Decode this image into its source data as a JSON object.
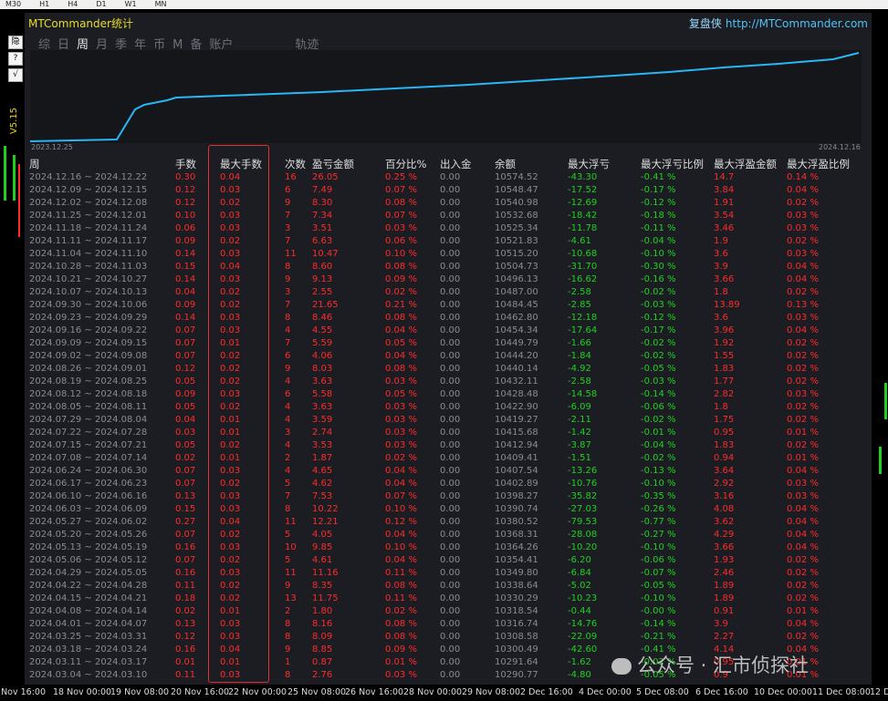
{
  "toolbar": {
    "items": [
      "M30",
      "H1",
      "H4",
      "D1",
      "W1",
      "MN"
    ]
  },
  "side": {
    "version": "V5.15",
    "buttons": [
      "隐",
      "?",
      "√"
    ]
  },
  "panel": {
    "title": "MTCommander统计",
    "brand_cn": "复盘侠",
    "brand_url": "http://MTCommander.com",
    "tabs": [
      "综",
      "日",
      "周",
      "月",
      "季",
      "年",
      "币",
      "M",
      "备",
      "账户",
      "轨迹"
    ],
    "active_tab": "周"
  },
  "equity_chart": {
    "start_date": "2023.12.25",
    "end_date": "2024.12.16"
  },
  "columns": [
    "周",
    "手数",
    "最大手数",
    "次数",
    "盈亏金额",
    "百分比%",
    "出入金",
    "余额",
    "最大浮亏",
    "最大浮亏比例",
    "最大浮盈金额",
    "最大浮盈比例"
  ],
  "rows": [
    [
      "2024.12.16 ~ 2024.12.22",
      "0.30",
      "0.04",
      "16",
      "26.05",
      "0.25 %",
      "0.00",
      "10574.52",
      "-43.30",
      "-0.41 %",
      "14.7",
      "0.14 %"
    ],
    [
      "2024.12.09 ~ 2024.12.15",
      "0.12",
      "0.03",
      "6",
      "7.49",
      "0.07 %",
      "0.00",
      "10548.47",
      "-17.52",
      "-0.17 %",
      "3.84",
      "0.04 %"
    ],
    [
      "2024.12.02 ~ 2024.12.08",
      "0.12",
      "0.02",
      "9",
      "8.30",
      "0.08 %",
      "0.00",
      "10540.98",
      "-12.69",
      "-0.12 %",
      "1.91",
      "0.02 %"
    ],
    [
      "2024.11.25 ~ 2024.12.01",
      "0.10",
      "0.03",
      "7",
      "7.34",
      "0.07 %",
      "0.00",
      "10532.68",
      "-18.42",
      "-0.18 %",
      "3.54",
      "0.03 %"
    ],
    [
      "2024.11.18 ~ 2024.11.24",
      "0.06",
      "0.03",
      "3",
      "3.51",
      "0.03 %",
      "0.00",
      "10525.34",
      "-11.78",
      "-0.11 %",
      "3.46",
      "0.03 %"
    ],
    [
      "2024.11.11 ~ 2024.11.17",
      "0.09",
      "0.02",
      "7",
      "6.63",
      "0.06 %",
      "0.00",
      "10521.83",
      "-4.61",
      "-0.04 %",
      "1.9",
      "0.02 %"
    ],
    [
      "2024.11.04 ~ 2024.11.10",
      "0.14",
      "0.03",
      "11",
      "10.47",
      "0.10 %",
      "0.00",
      "10515.20",
      "-10.68",
      "-0.10 %",
      "3.6",
      "0.03 %"
    ],
    [
      "2024.10.28 ~ 2024.11.03",
      "0.15",
      "0.04",
      "8",
      "8.60",
      "0.08 %",
      "0.00",
      "10504.73",
      "-31.70",
      "-0.30 %",
      "3.9",
      "0.04 %"
    ],
    [
      "2024.10.21 ~ 2024.10.27",
      "0.14",
      "0.03",
      "9",
      "9.13",
      "0.09 %",
      "0.00",
      "10496.13",
      "-16.62",
      "-0.16 %",
      "3.66",
      "0.04 %"
    ],
    [
      "2024.10.07 ~ 2024.10.13",
      "0.04",
      "0.02",
      "3",
      "2.55",
      "0.02 %",
      "0.00",
      "10487.00",
      "-2.58",
      "-0.02 %",
      "1.8",
      "0.02 %"
    ],
    [
      "2024.09.30 ~ 2024.10.06",
      "0.09",
      "0.02",
      "7",
      "21.65",
      "0.21 %",
      "0.00",
      "10484.45",
      "-2.85",
      "-0.03 %",
      "13.89",
      "0.13 %"
    ],
    [
      "2024.09.23 ~ 2024.09.29",
      "0.14",
      "0.03",
      "8",
      "8.46",
      "0.08 %",
      "0.00",
      "10462.80",
      "-12.18",
      "-0.12 %",
      "3.6",
      "0.03 %"
    ],
    [
      "2024.09.16 ~ 2024.09.22",
      "0.07",
      "0.03",
      "4",
      "4.55",
      "0.04 %",
      "0.00",
      "10454.34",
      "-17.64",
      "-0.17 %",
      "3.96",
      "0.04 %"
    ],
    [
      "2024.09.09 ~ 2024.09.15",
      "0.07",
      "0.01",
      "7",
      "5.59",
      "0.05 %",
      "0.00",
      "10449.79",
      "-1.66",
      "-0.02 %",
      "1.92",
      "0.02 %"
    ],
    [
      "2024.09.02 ~ 2024.09.08",
      "0.07",
      "0.02",
      "6",
      "4.06",
      "0.04 %",
      "0.00",
      "10444.20",
      "-1.84",
      "-0.02 %",
      "1.55",
      "0.02 %"
    ],
    [
      "2024.08.26 ~ 2024.09.01",
      "0.12",
      "0.02",
      "9",
      "8.03",
      "0.08 %",
      "0.00",
      "10440.14",
      "-4.92",
      "-0.05 %",
      "1.83",
      "0.02 %"
    ],
    [
      "2024.08.19 ~ 2024.08.25",
      "0.05",
      "0.02",
      "4",
      "3.63",
      "0.03 %",
      "0.00",
      "10432.11",
      "-2.58",
      "-0.03 %",
      "1.77",
      "0.02 %"
    ],
    [
      "2024.08.12 ~ 2024.08.18",
      "0.09",
      "0.03",
      "6",
      "5.58",
      "0.05 %",
      "0.00",
      "10428.48",
      "-14.58",
      "-0.14 %",
      "2.82",
      "0.03 %"
    ],
    [
      "2024.08.05 ~ 2024.08.11",
      "0.05",
      "0.02",
      "4",
      "3.63",
      "0.03 %",
      "0.00",
      "10422.90",
      "-6.09",
      "-0.06 %",
      "1.8",
      "0.02 %"
    ],
    [
      "2024.07.29 ~ 2024.08.04",
      "0.04",
      "0.01",
      "4",
      "3.59",
      "0.03 %",
      "0.00",
      "10419.27",
      "-2.11",
      "-0.02 %",
      "1.75",
      "0.02 %"
    ],
    [
      "2024.07.22 ~ 2024.07.28",
      "0.03",
      "0.01",
      "3",
      "2.74",
      "0.03 %",
      "0.00",
      "10415.68",
      "-1.42",
      "-0.01 %",
      "0.95",
      "0.01 %"
    ],
    [
      "2024.07.15 ~ 2024.07.21",
      "0.05",
      "0.02",
      "4",
      "3.53",
      "0.03 %",
      "0.00",
      "10412.94",
      "-3.87",
      "-0.04 %",
      "1.83",
      "0.02 %"
    ],
    [
      "2024.07.08 ~ 2024.07.14",
      "0.02",
      "0.01",
      "2",
      "1.87",
      "0.02 %",
      "0.00",
      "10409.41",
      "-1.51",
      "-0.02 %",
      "0.94",
      "0.01 %"
    ],
    [
      "2024.06.24 ~ 2024.06.30",
      "0.07",
      "0.03",
      "4",
      "4.65",
      "0.04 %",
      "0.00",
      "10407.54",
      "-13.26",
      "-0.13 %",
      "3.64",
      "0.04 %"
    ],
    [
      "2024.06.17 ~ 2024.06.23",
      "0.07",
      "0.02",
      "5",
      "4.62",
      "0.04 %",
      "0.00",
      "10402.89",
      "-10.76",
      "-0.10 %",
      "2.92",
      "0.03 %"
    ],
    [
      "2024.06.10 ~ 2024.06.16",
      "0.13",
      "0.03",
      "7",
      "7.53",
      "0.07 %",
      "0.00",
      "10398.27",
      "-35.82",
      "-0.35 %",
      "3.16",
      "0.03 %"
    ],
    [
      "2024.06.03 ~ 2024.06.09",
      "0.15",
      "0.03",
      "8",
      "10.22",
      "0.10 %",
      "0.00",
      "10390.74",
      "-27.03",
      "-0.26 %",
      "4.08",
      "0.04 %"
    ],
    [
      "2024.05.27 ~ 2024.06.02",
      "0.27",
      "0.04",
      "11",
      "12.21",
      "0.12 %",
      "0.00",
      "10380.52",
      "-79.53",
      "-0.77 %",
      "3.62",
      "0.04 %"
    ],
    [
      "2024.05.20 ~ 2024.05.26",
      "0.07",
      "0.02",
      "5",
      "4.05",
      "0.04 %",
      "0.00",
      "10368.31",
      "-28.08",
      "-0.27 %",
      "4.29",
      "0.04 %"
    ],
    [
      "2024.05.13 ~ 2024.05.19",
      "0.16",
      "0.03",
      "10",
      "9.85",
      "0.10 %",
      "0.00",
      "10364.26",
      "-10.20",
      "-0.10 %",
      "3.66",
      "0.04 %"
    ],
    [
      "2024.05.06 ~ 2024.05.12",
      "0.07",
      "0.02",
      "5",
      "4.61",
      "0.04 %",
      "0.00",
      "10354.41",
      "-6.20",
      "-0.06 %",
      "1.93",
      "0.02 %"
    ],
    [
      "2024.04.29 ~ 2024.05.05",
      "0.16",
      "0.03",
      "11",
      "11.16",
      "0.11 %",
      "0.00",
      "10349.80",
      "-6.84",
      "-0.07 %",
      "2.46",
      "0.02 %"
    ],
    [
      "2024.04.22 ~ 2024.04.28",
      "0.11",
      "0.02",
      "9",
      "8.35",
      "0.08 %",
      "0.00",
      "10338.64",
      "-5.02",
      "-0.05 %",
      "1.89",
      "0.02 %"
    ],
    [
      "2024.04.15 ~ 2024.04.21",
      "0.18",
      "0.02",
      "13",
      "11.75",
      "0.11 %",
      "0.00",
      "10330.29",
      "-10.23",
      "-0.10 %",
      "1.89",
      "0.02 %"
    ],
    [
      "2024.04.08 ~ 2024.04.14",
      "0.02",
      "0.01",
      "2",
      "1.80",
      "0.02 %",
      "0.00",
      "10318.54",
      "-0.44",
      "-0.00 %",
      "0.91",
      "0.01 %"
    ],
    [
      "2024.04.01 ~ 2024.04.07",
      "0.13",
      "0.03",
      "8",
      "8.16",
      "0.08 %",
      "0.00",
      "10316.74",
      "-14.76",
      "-0.14 %",
      "3.9",
      "0.04 %"
    ],
    [
      "2024.03.25 ~ 2024.03.31",
      "0.12",
      "0.03",
      "8",
      "8.09",
      "0.08 %",
      "0.00",
      "10308.58",
      "-22.09",
      "-0.21 %",
      "2.27",
      "0.02 %"
    ],
    [
      "2024.03.18 ~ 2024.03.24",
      "0.16",
      "0.04",
      "9",
      "8.85",
      "0.09 %",
      "0.00",
      "10300.49",
      "-42.60",
      "-0.41 %",
      "4.14",
      "0.04 %"
    ],
    [
      "2024.03.11 ~ 2024.03.17",
      "0.01",
      "0.01",
      "1",
      "0.87",
      "0.01 %",
      "0.00",
      "10291.64",
      "-1.62",
      "-0.02 %",
      "0.95",
      "0.01 %"
    ],
    [
      "2024.03.04 ~ 2024.03.10",
      "0.11",
      "0.03",
      "8",
      "2.76",
      "0.03 %",
      "0.00",
      "10290.77",
      "-4.80",
      "-0.05 %",
      "0.9",
      "0.01 %"
    ]
  ],
  "x_axis": [
    "4 Nov 16:00",
    "18 Nov 00:00",
    "19 Nov 08:00",
    "20 Nov 16:00",
    "22 Nov 00:00",
    "25 Nov 08:00",
    "26 Nov 16:00",
    "28 Nov 00:00",
    "29 Nov 08:00",
    "2 Dec 16:00",
    "4 Dec 00:00",
    "5 Dec 08:00",
    "6 Dec 16:00",
    "10 Dec 00:00",
    "11 Dec 08:00",
    "12 D"
  ],
  "watermark": "公众号 · 汇市侦探社",
  "colors": {
    "positive": "#ff2b2b",
    "negative": "#20d020",
    "equity_line": "#29b6f6",
    "title": "#e6dc2c",
    "highlight_box": "#e03030"
  }
}
